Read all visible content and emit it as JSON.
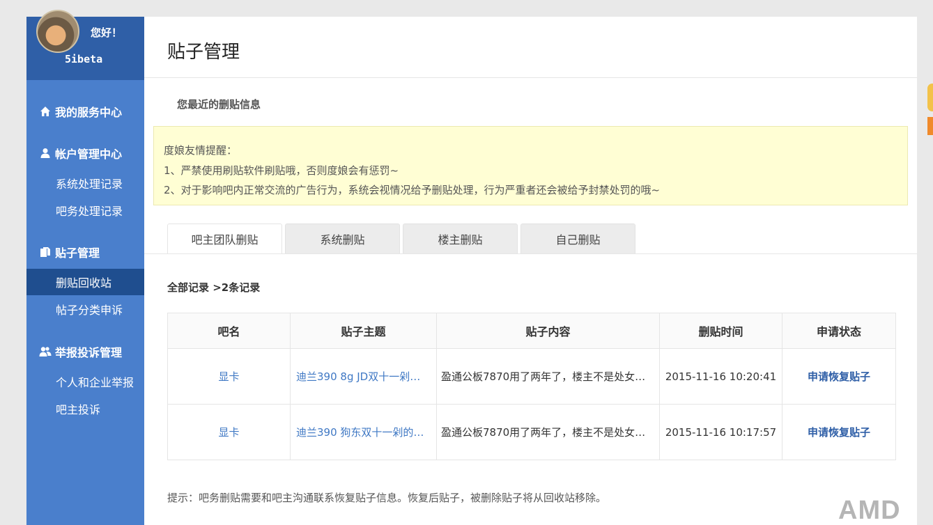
{
  "profile": {
    "greeting": "您好！",
    "username": "5ibeta"
  },
  "sidebar": {
    "sections": [
      {
        "label": "我的服务中心",
        "icon": "home-icon"
      },
      {
        "label": "帐户管理中心",
        "icon": "user-icon"
      },
      {
        "label": "贴子管理",
        "icon": "document-icon"
      },
      {
        "label": "举报投诉管理",
        "icon": "users-icon"
      }
    ],
    "items": [
      {
        "label": "系统处理记录"
      },
      {
        "label": "吧务处理记录"
      },
      {
        "label": "删贴回收站",
        "active": true
      },
      {
        "label": "帖子分类申诉"
      },
      {
        "label": "个人和企业举报"
      },
      {
        "label": "吧主投诉"
      }
    ]
  },
  "main": {
    "title": "贴子管理",
    "subheading": "您最近的删贴信息",
    "notice": {
      "heading": "度娘友情提醒：",
      "lines": [
        "1、严禁使用刷贴软件刷贴哦，否则度娘会有惩罚~",
        "2、对于影响吧内正常交流的广告行为，系统会视情况给予删贴处理，行为严重者还会被给予封禁处罚的哦~"
      ]
    },
    "tabs": [
      {
        "label": "吧主团队删贴",
        "active": true
      },
      {
        "label": "系统删贴"
      },
      {
        "label": "楼主删贴"
      },
      {
        "label": "自己删贴"
      }
    ],
    "records_summary": "全部记录 >2条记录",
    "table": {
      "headers": [
        "吧名",
        "贴子主题",
        "贴子内容",
        "删贴时间",
        "申请状态"
      ],
      "rows": [
        [
          "显卡",
          "迪兰390 8g JD双十一剁…",
          "盈通公板7870用了两年了，楼主不是处女…",
          "2015-11-16 10:20:41",
          "申请恢复贴子"
        ],
        [
          "显卡",
          "迪兰390 狗东双十一剁的…",
          "盈通公板7870用了两年了，楼主不是处女…",
          "2015-11-16 10:17:57",
          "申请恢复贴子"
        ]
      ]
    },
    "footer_tip": "提示：吧务删贴需要和吧主沟通联系恢复贴子信息。恢复后贴子，被删除贴子将从回收站移除。"
  },
  "watermark": "AMD",
  "colors": {
    "sidebar": "#4a7fcc",
    "sidebar_header": "#2f5fa7",
    "sidebar_active": "#1f4e8f",
    "link": "#3f78c4",
    "notice_bg": "#fffed4"
  }
}
